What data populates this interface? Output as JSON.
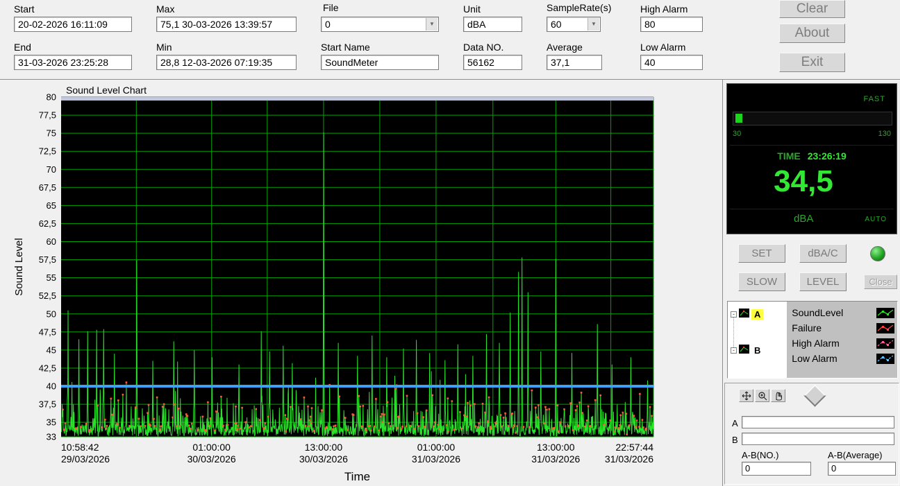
{
  "header": {
    "start": {
      "label": "Start",
      "value": "20-02-2026 16:11:09"
    },
    "end": {
      "label": "End",
      "value": "31-03-2026 23:25:28"
    },
    "max": {
      "label": "Max",
      "value": "75,1 30-03-2026 13:39:57"
    },
    "min": {
      "label": "Min",
      "value": "28,8 12-03-2026 07:19:35"
    },
    "file": {
      "label": "File",
      "value": "0"
    },
    "start_name": {
      "label": "Start Name",
      "value": "SoundMeter"
    },
    "unit": {
      "label": "Unit",
      "value": "dBA"
    },
    "data_no": {
      "label": "Data NO.",
      "value": "56162"
    },
    "sample_rate": {
      "label": "SampleRate(s)",
      "value": "60"
    },
    "average": {
      "label": "Average",
      "value": "37,1"
    },
    "high_alarm": {
      "label": "High Alarm",
      "value": "80"
    },
    "low_alarm": {
      "label": "Low Alarm",
      "value": "40"
    },
    "buttons": {
      "clear": "Clear",
      "about": "About",
      "exit": "Exit"
    }
  },
  "chart_data": {
    "type": "line",
    "title": "Sound Level Chart",
    "xlabel": "Time",
    "ylabel": "Sound Level",
    "ylim": [
      33,
      80
    ],
    "grid": true,
    "bg": "#000000",
    "grid_color": "#00a400",
    "series_color": "#2be22b",
    "marker_color": "#ff5a36",
    "high_alarm_line": {
      "value": 80,
      "color": "#c2c7de"
    },
    "low_alarm_line": {
      "value": 40,
      "color": "#3da1f8"
    },
    "yticks": [
      33,
      35,
      37.5,
      40,
      42.5,
      45,
      47.5,
      50,
      52.5,
      55,
      57.5,
      60,
      62.5,
      65,
      67.5,
      70,
      72.5,
      75,
      77.5,
      80
    ],
    "ytick_labels": [
      "33",
      "35",
      "37,5",
      "40",
      "42,5",
      "45",
      "47,5",
      "50",
      "52,5",
      "55",
      "57,5",
      "60",
      "62,5",
      "65",
      "67,5",
      "70",
      "72,5",
      "75",
      "77,5",
      "80"
    ],
    "xticks": [
      {
        "pos": 0.0,
        "time": "10:58:42",
        "date": "29/03/2026"
      },
      {
        "pos": 0.254,
        "time": "01:00:00",
        "date": "30/03/2026"
      },
      {
        "pos": 0.443,
        "time": "13:00:00",
        "date": "30/03/2026"
      },
      {
        "pos": 0.633,
        "time": "01:00:00",
        "date": "31/03/2026"
      },
      {
        "pos": 0.835,
        "time": "13:00:00",
        "date": "31/03/2026"
      },
      {
        "pos": 1.0,
        "time": "22:57:44",
        "date": "31/03/2026"
      }
    ],
    "vgrid": [
      0.127,
      0.254,
      0.348,
      0.443,
      0.538,
      0.633,
      0.729,
      0.835,
      0.928,
      1.0
    ],
    "baseline": {
      "min": 33.1,
      "typ": 34.5
    },
    "seed": 1356,
    "n_points": 1700,
    "max_point": {
      "value": 75.1,
      "x": 0.443
    },
    "peaks": [
      {
        "x": 0.012,
        "v": 50.5
      },
      {
        "x": 0.03,
        "v": 46.5
      },
      {
        "x": 0.045,
        "v": 47.6
      },
      {
        "x": 0.06,
        "v": 47.8
      },
      {
        "x": 0.072,
        "v": 47.9
      },
      {
        "x": 0.09,
        "v": 44.5
      },
      {
        "x": 0.128,
        "v": 57.4
      },
      {
        "x": 0.155,
        "v": 43.5
      },
      {
        "x": 0.19,
        "v": 46.2
      },
      {
        "x": 0.225,
        "v": 45.0
      },
      {
        "x": 0.255,
        "v": 44.0
      },
      {
        "x": 0.3,
        "v": 43.0
      },
      {
        "x": 0.338,
        "v": 47.6
      },
      {
        "x": 0.352,
        "v": 44.8
      },
      {
        "x": 0.375,
        "v": 45.6
      },
      {
        "x": 0.39,
        "v": 43.2
      },
      {
        "x": 0.443,
        "v": 75.1
      },
      {
        "x": 0.468,
        "v": 46.0
      },
      {
        "x": 0.5,
        "v": 44.2
      },
      {
        "x": 0.525,
        "v": 47.0
      },
      {
        "x": 0.55,
        "v": 44.0
      },
      {
        "x": 0.578,
        "v": 45.2
      },
      {
        "x": 0.6,
        "v": 46.4
      },
      {
        "x": 0.622,
        "v": 44.6
      },
      {
        "x": 0.648,
        "v": 43.6
      },
      {
        "x": 0.67,
        "v": 45.8
      },
      {
        "x": 0.695,
        "v": 44.2
      },
      {
        "x": 0.718,
        "v": 47.2
      },
      {
        "x": 0.74,
        "v": 46.0
      },
      {
        "x": 0.758,
        "v": 50.2
      },
      {
        "x": 0.772,
        "v": 55.8
      },
      {
        "x": 0.778,
        "v": 57.8
      },
      {
        "x": 0.788,
        "v": 53.0
      },
      {
        "x": 0.81,
        "v": 44.8
      },
      {
        "x": 0.835,
        "v": 57.6
      },
      {
        "x": 0.862,
        "v": 44.6
      },
      {
        "x": 0.905,
        "v": 48.6
      },
      {
        "x": 0.93,
        "v": 43.0
      },
      {
        "x": 0.962,
        "v": 44.0
      },
      {
        "x": 0.99,
        "v": 40.8
      }
    ]
  },
  "meter": {
    "mode": "FAST",
    "scale_min": "30",
    "scale_max": "130",
    "time_label": "TIME",
    "time_value": "23:26:19",
    "value": "34,5",
    "unit": "dBA",
    "range_mode": "AUTO",
    "bar_fraction": 0.045
  },
  "controls": {
    "set": "SET",
    "dbac": "dBA/C",
    "slow": "SLOW",
    "level": "LEVEL",
    "close": "Close"
  },
  "legend": {
    "tree": [
      {
        "label": "A",
        "selected": true
      },
      {
        "label": "B",
        "selected": false
      }
    ],
    "items": [
      {
        "label": "SoundLevel",
        "color": "#2be22b",
        "dash": ""
      },
      {
        "label": "Failure",
        "color": "#ff4040",
        "dash": ""
      },
      {
        "label": "High Alarm",
        "color": "#ff5f9e",
        "dash": "3,2"
      },
      {
        "label": "Low Alarm",
        "color": "#5ac8ff",
        "dash": "3,2"
      }
    ]
  },
  "cursor_panel": {
    "a_label": "A",
    "b_label": "B",
    "a_value": "",
    "b_value": "",
    "ab_no_label": "A-B(NO.)",
    "ab_no_value": "0",
    "ab_avg_label": "A-B(Average)",
    "ab_avg_value": "0"
  }
}
